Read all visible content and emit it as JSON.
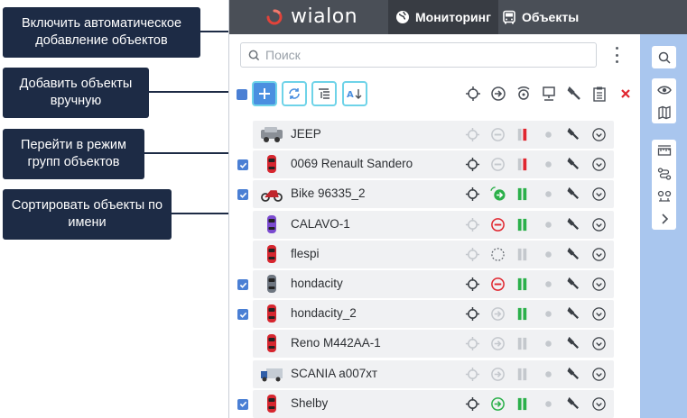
{
  "callouts": {
    "auto_add": "Включить автоматическое добавление объектов",
    "add_manual": "Добавить объекты вручную",
    "group_mode": "Перейти в режим групп объектов",
    "sort_name": "Сортировать объекты по имени"
  },
  "app": {
    "logo_text": "wialon",
    "tabs": [
      {
        "label": "Мониторинг",
        "icon": "globe-icon",
        "active": true
      },
      {
        "label": "Объекты",
        "icon": "bus-icon",
        "active": false
      }
    ],
    "search": {
      "placeholder": "Поиск",
      "value": ""
    },
    "colors": {
      "topbar": "#4a4f57",
      "accent": "#4a8fe0",
      "highlight": "#6ed3e8",
      "sidebar": "#a9c6ee",
      "ok": "#2bb04a",
      "error": "#e0262f"
    }
  },
  "units": [
    {
      "name": "JEEP",
      "checked": false,
      "icon": "jeep-icon",
      "locate": "inactive",
      "status": "minus-gray",
      "signal": "gray-red",
      "dot": "gray"
    },
    {
      "name": "0069 Renault Sandero",
      "checked": true,
      "icon": "red-car-icon",
      "locate": "active",
      "status": "minus-gray",
      "signal": "gray-red",
      "dot": "gray"
    },
    {
      "name": "Bike 96335_2",
      "checked": true,
      "icon": "motorbike-icon",
      "locate": "active",
      "status": "arrow-green-moving",
      "signal": "green",
      "dot": "gray"
    },
    {
      "name": "CALAVO-1",
      "checked": false,
      "icon": "purple-car-icon",
      "locate": "inactive",
      "status": "minus-red",
      "signal": "green",
      "dot": "gray"
    },
    {
      "name": "flespi",
      "checked": false,
      "icon": "red-car-icon",
      "locate": "inactive",
      "status": "dashed-circle",
      "signal": "gray",
      "dot": "gray"
    },
    {
      "name": "hondacity",
      "checked": true,
      "icon": "gray-car-icon",
      "locate": "active",
      "status": "minus-red",
      "signal": "green",
      "dot": "gray"
    },
    {
      "name": "hondacity_2",
      "checked": true,
      "icon": "red-car-icon",
      "locate": "active",
      "status": "arrow-gray",
      "signal": "green",
      "dot": "gray"
    },
    {
      "name": "Reno M442AA-1",
      "checked": false,
      "icon": "red-car-icon",
      "locate": "inactive",
      "status": "arrow-gray",
      "signal": "gray",
      "dot": "gray"
    },
    {
      "name": "SCANIA а007хт",
      "checked": false,
      "icon": "truck-icon",
      "locate": "inactive",
      "status": "arrow-gray",
      "signal": "gray",
      "dot": "gray"
    },
    {
      "name": "Shelby",
      "checked": true,
      "icon": "red-car-icon",
      "locate": "active",
      "status": "arrow-green",
      "signal": "green",
      "dot": "gray"
    }
  ]
}
